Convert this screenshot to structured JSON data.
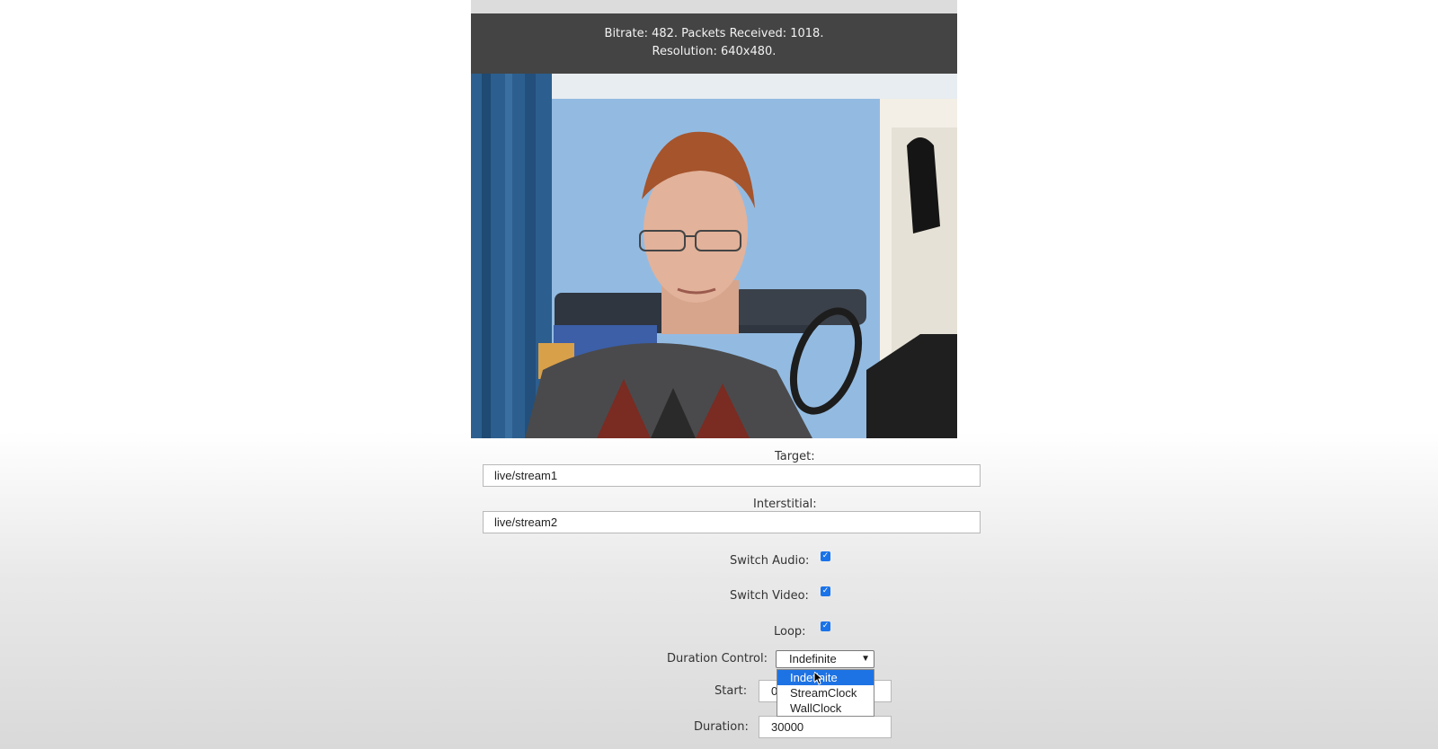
{
  "stats": {
    "line1": "Bitrate: 482.  Packets Received: 1018.",
    "line2": "Resolution: 640x480."
  },
  "form": {
    "target_label": "Target:",
    "target_value": "live/stream1",
    "interstitial_label": "Interstitial:",
    "interstitial_value": "live/stream2",
    "switch_audio_label": "Switch Audio:",
    "switch_audio_checked": true,
    "switch_video_label": "Switch Video:",
    "switch_video_checked": true,
    "loop_label": "Loop:",
    "loop_checked": true,
    "duration_control_label": "Duration Control:",
    "duration_control_value": "Indefinite",
    "duration_control_options": [
      "Indefinite",
      "StreamClock",
      "WallClock"
    ],
    "start_label": "Start:",
    "start_value": "0",
    "duration_label": "Duration:",
    "duration_value": "30000"
  },
  "icons": {
    "checkbox": "checkmark-icon",
    "select": "chevron-down-icon"
  },
  "colors": {
    "stats_bg": "#444444",
    "checkbox": "#1a73e8",
    "selected_option": "#1e73e4"
  }
}
